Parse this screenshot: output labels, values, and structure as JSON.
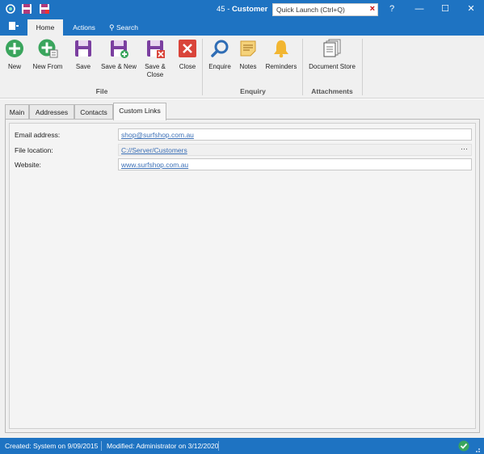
{
  "window": {
    "record_number": "45",
    "title_separator": " - ",
    "title": "Customer",
    "quick_launch_placeholder": "Quick Launch (Ctrl+Q)",
    "help_label": "?",
    "minimize_label": "—",
    "maximize_label": "☐",
    "close_label": "✕"
  },
  "menu": {
    "file_icon": "file-menu-icon",
    "tabs": [
      {
        "label": "Home",
        "active": true
      },
      {
        "label": "Actions",
        "active": false
      },
      {
        "label": "Search",
        "active": false,
        "icon": "search-icon"
      }
    ]
  },
  "ribbon": {
    "groups": [
      {
        "label": "File",
        "buttons": [
          "New",
          "New From",
          "Save",
          "Save & New",
          "Save &\nClose",
          "Close"
        ]
      },
      {
        "label": "Enquiry",
        "buttons": [
          "Enquire",
          "Notes",
          "Reminders"
        ]
      },
      {
        "label": "Attachments",
        "buttons": [
          "Document Store"
        ]
      }
    ]
  },
  "tabs": [
    {
      "label": "Main",
      "active": false
    },
    {
      "label": "Addresses",
      "active": false
    },
    {
      "label": "Contacts",
      "active": false
    },
    {
      "label": "Custom Links",
      "active": true
    }
  ],
  "custom_links": {
    "email_label": "Email address:",
    "email_value": "shop@surfshop.com.au",
    "file_label": "File location:",
    "file_value": "C://Server/Customers",
    "file_browse": "···",
    "website_label": "Website:",
    "website_value": "www.surfshop.com.au"
  },
  "status": {
    "created": "Created: System on 9/09/2015",
    "modified": "Modified: Administrator on 3/12/2020",
    "ok_icon": "check-circle-icon"
  },
  "colors": {
    "accent": "#1e73c2",
    "new_green": "#3aa55d",
    "save_purple": "#7b3fa0",
    "close_red": "#d9443a",
    "enquire_blue": "#2f6db5",
    "notes_yellow": "#e8b84a",
    "reminder_yellow": "#f2b632"
  }
}
